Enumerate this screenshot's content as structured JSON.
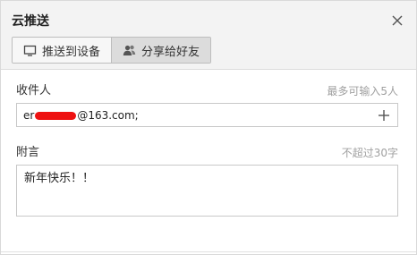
{
  "dialog": {
    "title": "云推送",
    "close_icon": "close-icon"
  },
  "tabs": [
    {
      "label": "推送到设备",
      "icon": "monitor-icon",
      "active": false
    },
    {
      "label": "分享给好友",
      "icon": "friends-icon",
      "active": true
    }
  ],
  "recipient": {
    "label": "收件人",
    "hint": "最多可输入5人",
    "value_prefix": "er",
    "value_suffix": "@163.com;",
    "add_icon": "plus-icon"
  },
  "note": {
    "label": "附言",
    "hint": "不超过30字",
    "value": "新年快乐！！"
  },
  "colors": {
    "header_bg": "#f3f3f3",
    "active_tab_bg": "#dcdcdc",
    "hint_text": "#a0a0a0",
    "redaction": "#ee1111"
  }
}
